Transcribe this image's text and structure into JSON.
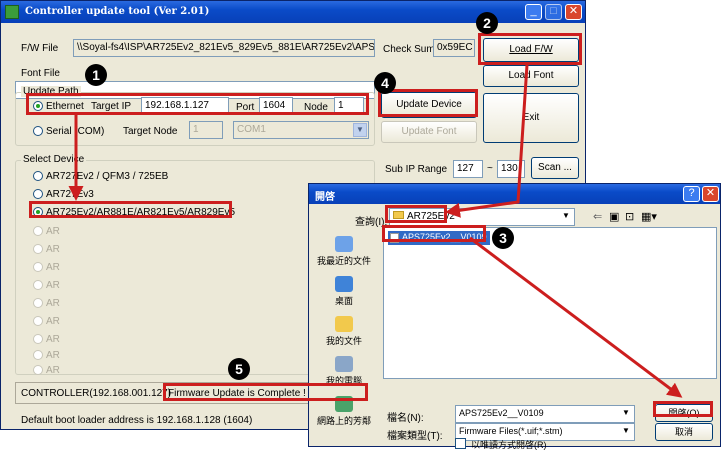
{
  "main": {
    "title": "Controller update tool  (Ver 2.01)",
    "fw_file_label": "F/W File",
    "fw_file_value": "\\\\Soyal-fs4\\ISP\\AR725Ev2_821Ev5_829Ev5_881E\\AR725Ev2\\APS72",
    "check_sum_label": "Check Sum",
    "check_sum_value": "0x59EC",
    "load_fw_label": "Load F/W",
    "font_file_label": "Font File",
    "font_file_value": "",
    "load_font_label": "Load Font",
    "update_path_title": "Update Path",
    "ethernet_label": "Ethernet",
    "target_ip_label": "Target IP",
    "target_ip_value": "192.168.1.127",
    "port_label": "Port",
    "port_value": "1604",
    "node_label": "Node",
    "node_value": "1",
    "update_device_label": "Update Device",
    "exit_label": "Exit",
    "serial_label": "Serial (COM)",
    "target_node_label": "Target Node",
    "target_node_value": "1",
    "com_value": "COM1",
    "update_font_label": "Update Font",
    "select_device_title": "Select Device",
    "devices": [
      "AR727Ev2 / QFM3 / 725EB",
      "AR727Ev3",
      "AR725Ev2/AR881E/AR821Ev5/AR829Ev5",
      "AR",
      "AR",
      "AR",
      "AR",
      "AR",
      "AR",
      "AR",
      "AR",
      "AR"
    ],
    "sub_ip_range_label": "Sub IP Range",
    "sub_ip_from": "127",
    "sub_ip_tilde": "~",
    "sub_ip_to": "130",
    "scan_label": "Scan ...",
    "status_controller": "CONTROLLER(192.168.001.127)",
    "status_message": "Firmware Update is Complete !",
    "footer_text": "Default boot loader address is 192.168.1.128 (1604)"
  },
  "dialog": {
    "title": "開啓",
    "look_in_label": "查詢(I):",
    "look_in_value": "AR725Ev2",
    "file_item": "APS725Ev2__V0109",
    "places": [
      "我最近的文件",
      "桌面",
      "我的文件",
      "我的電腦",
      "網路上的芳鄰"
    ],
    "file_name_label": "檔名(N):",
    "file_name_value": "APS725Ev2__V0109",
    "file_type_label": "檔案類型(T):",
    "file_type_value": "Firmware Files(*.uif;*.stm)",
    "readonly_label": "以唯讀方式開啓(R)",
    "open_label": "開啓(O)",
    "cancel_label": "取消"
  },
  "badges": [
    "1",
    "2",
    "3",
    "4",
    "5"
  ],
  "colors": {
    "annotation_red": "#cc1e1e",
    "title_blue": "#0a4bc8",
    "window_bg": "#ece9d8",
    "selection_blue": "#316ac5"
  },
  "icons": [
    "app-icon",
    "minimize-icon",
    "maximize-icon",
    "close-icon",
    "help-icon",
    "folder-icon",
    "back-icon",
    "up-folder-icon",
    "new-folder-icon",
    "views-icon",
    "file-icon",
    "recent-icon",
    "desktop-icon",
    "documents-icon",
    "computer-icon",
    "network-icon"
  ]
}
